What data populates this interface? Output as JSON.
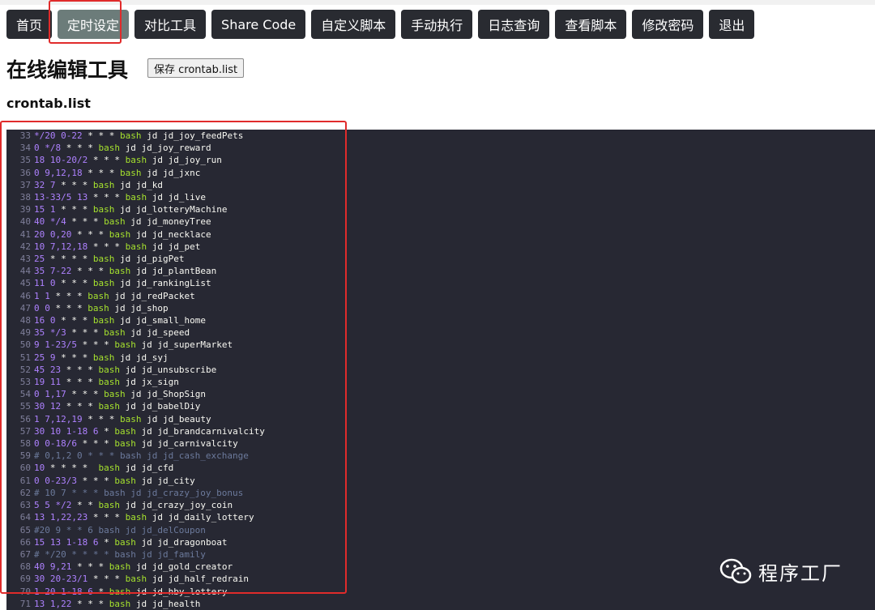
{
  "nav": {
    "items": [
      {
        "label": "首页",
        "active": false
      },
      {
        "label": "定时设定",
        "active": true
      },
      {
        "label": "对比工具",
        "active": false
      },
      {
        "label": "Share Code",
        "active": false
      },
      {
        "label": "自定义脚本",
        "active": false
      },
      {
        "label": "手动执行",
        "active": false
      },
      {
        "label": "日志查询",
        "active": false
      },
      {
        "label": "查看脚本",
        "active": false
      },
      {
        "label": "修改密码",
        "active": false
      },
      {
        "label": "退出",
        "active": false
      }
    ]
  },
  "page": {
    "title": "在线编辑工具",
    "save_label": "保存 crontab.list",
    "file_label": "crontab.list"
  },
  "editor": {
    "lines": [
      {
        "n": "33",
        "code": "*/20 0-22 * * * bash jd jd_joy_feedPets",
        "comment": false
      },
      {
        "n": "34",
        "code": "0 */8 * * * bash jd jd_joy_reward",
        "comment": false
      },
      {
        "n": "35",
        "code": "18 10-20/2 * * * bash jd jd_joy_run",
        "comment": false
      },
      {
        "n": "36",
        "code": "0 9,12,18 * * * bash jd jd_jxnc",
        "comment": false
      },
      {
        "n": "37",
        "code": "32 7 * * * bash jd jd_kd",
        "comment": false
      },
      {
        "n": "38",
        "code": "13-33/5 13 * * * bash jd jd_live",
        "comment": false
      },
      {
        "n": "39",
        "code": "15 1 * * * bash jd jd_lotteryMachine",
        "comment": false
      },
      {
        "n": "40",
        "code": "40 */4 * * * bash jd jd_moneyTree",
        "comment": false
      },
      {
        "n": "41",
        "code": "20 0,20 * * * bash jd jd_necklace",
        "comment": false
      },
      {
        "n": "42",
        "code": "10 7,12,18 * * * bash jd jd_pet",
        "comment": false
      },
      {
        "n": "43",
        "code": "25 * * * * bash jd jd_pigPet",
        "comment": false
      },
      {
        "n": "44",
        "code": "35 7-22 * * * bash jd jd_plantBean",
        "comment": false
      },
      {
        "n": "45",
        "code": "11 0 * * * bash jd jd_rankingList",
        "comment": false
      },
      {
        "n": "46",
        "code": "1 1 * * * bash jd jd_redPacket",
        "comment": false
      },
      {
        "n": "47",
        "code": "0 0 * * * bash jd jd_shop",
        "comment": false
      },
      {
        "n": "48",
        "code": "16 0 * * * bash jd jd_small_home",
        "comment": false
      },
      {
        "n": "49",
        "code": "35 */3 * * * bash jd jd_speed",
        "comment": false
      },
      {
        "n": "50",
        "code": "9 1-23/5 * * * bash jd jd_superMarket",
        "comment": false
      },
      {
        "n": "51",
        "code": "25 9 * * * bash jd jd_syj",
        "comment": false
      },
      {
        "n": "52",
        "code": "45 23 * * * bash jd jd_unsubscribe",
        "comment": false
      },
      {
        "n": "53",
        "code": "19 11 * * * bash jd jx_sign",
        "comment": false
      },
      {
        "n": "54",
        "code": "0 1,17 * * * bash jd jd_ShopSign",
        "comment": false
      },
      {
        "n": "55",
        "code": "30 12 * * * bash jd jd_babelDiy",
        "comment": false
      },
      {
        "n": "56",
        "code": "1 7,12,19 * * * bash jd jd_beauty",
        "comment": false
      },
      {
        "n": "57",
        "code": "30 10 1-18 6 * bash jd jd_brandcarnivalcity",
        "comment": false
      },
      {
        "n": "58",
        "code": "0 0-18/6 * * * bash jd jd_carnivalcity",
        "comment": false
      },
      {
        "n": "59",
        "code": "# 0,1,2 0 * * * bash jd jd_cash_exchange",
        "comment": true
      },
      {
        "n": "60",
        "code": "10 * * * *  bash jd jd_cfd",
        "comment": false
      },
      {
        "n": "61",
        "code": "0 0-23/3 * * * bash jd jd_city",
        "comment": false
      },
      {
        "n": "62",
        "code": "# 10 7 * * * bash jd jd_crazy_joy_bonus",
        "comment": true
      },
      {
        "n": "63",
        "code": "5 5 */2 * * bash jd jd_crazy_joy_coin",
        "comment": false
      },
      {
        "n": "64",
        "code": "13 1,22,23 * * * bash jd jd_daily_lottery",
        "comment": false
      },
      {
        "n": "65",
        "code": "#20 9 * * 6 bash jd jd_delCoupon",
        "comment": true
      },
      {
        "n": "66",
        "code": "15 13 1-18 6 * bash jd jd_dragonboat",
        "comment": false
      },
      {
        "n": "67",
        "code": "# */20 * * * * bash jd jd_family",
        "comment": true
      },
      {
        "n": "68",
        "code": "40 9,21 * * * bash jd jd_gold_creator",
        "comment": false
      },
      {
        "n": "69",
        "code": "30 20-23/1 * * * bash jd jd_half_redrain",
        "comment": false
      },
      {
        "n": "70",
        "code": "1 20 1-18 6 * bash jd jd_hby_lottery",
        "comment": false
      },
      {
        "n": "71",
        "code": "13 1,22 * * * bash jd jd_health",
        "comment": false
      }
    ]
  },
  "watermark": {
    "text": "程序工厂",
    "icon": "wechat-icon"
  },
  "colors": {
    "nav_bg": "#292b31",
    "nav_active": "#6c7c7a",
    "editor_bg": "#272833",
    "highlight": "#e02b2b"
  }
}
